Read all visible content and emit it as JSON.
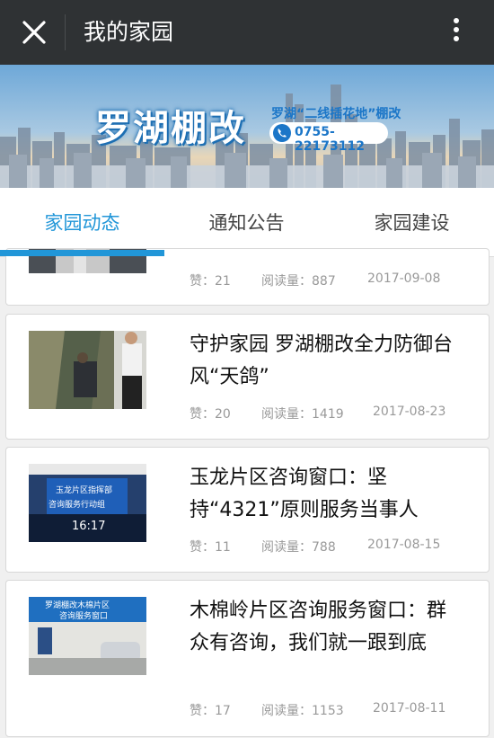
{
  "header": {
    "title": "我的家园",
    "close_icon": "close-icon",
    "more_icon": "more-vertical-icon"
  },
  "banner": {
    "brand": "罗湖棚改",
    "slogan": "罗湖“二线插花地”棚改",
    "phone": "0755-22173112"
  },
  "tabs": [
    {
      "label": "家园动态"
    },
    {
      "label": "通知公告"
    },
    {
      "label": "家园建设"
    }
  ],
  "articles": [
    {
      "title": "",
      "likes": "赞：21",
      "reads": "阅读量：887",
      "date": "2017-09-08"
    },
    {
      "title": "守护家园 罗湖棚改全力防御台风“天鸽”",
      "likes": "赞：20",
      "reads": "阅读量：1419",
      "date": "2017-08-23"
    },
    {
      "title": "玉龙片区咨询窗口：坚持“4321”原则服务当事人",
      "likes": "赞：11",
      "reads": "阅读量：788",
      "date": "2017-08-15",
      "thumb_texts": [
        "玉龙片区指挥部",
        "咨询服务行动组",
        "16:17"
      ]
    },
    {
      "title": "木棉岭片区咨询服务窗口：群众有咨询，我们就一跟到底",
      "likes": "赞：17",
      "reads": "阅读量：1153",
      "date": "2017-08-11",
      "thumb_texts": [
        "罗湖棚改木棉片区",
        "咨询服务窗口"
      ]
    }
  ],
  "colors": {
    "accent": "#2196d8",
    "topbar": "#2f3234"
  }
}
